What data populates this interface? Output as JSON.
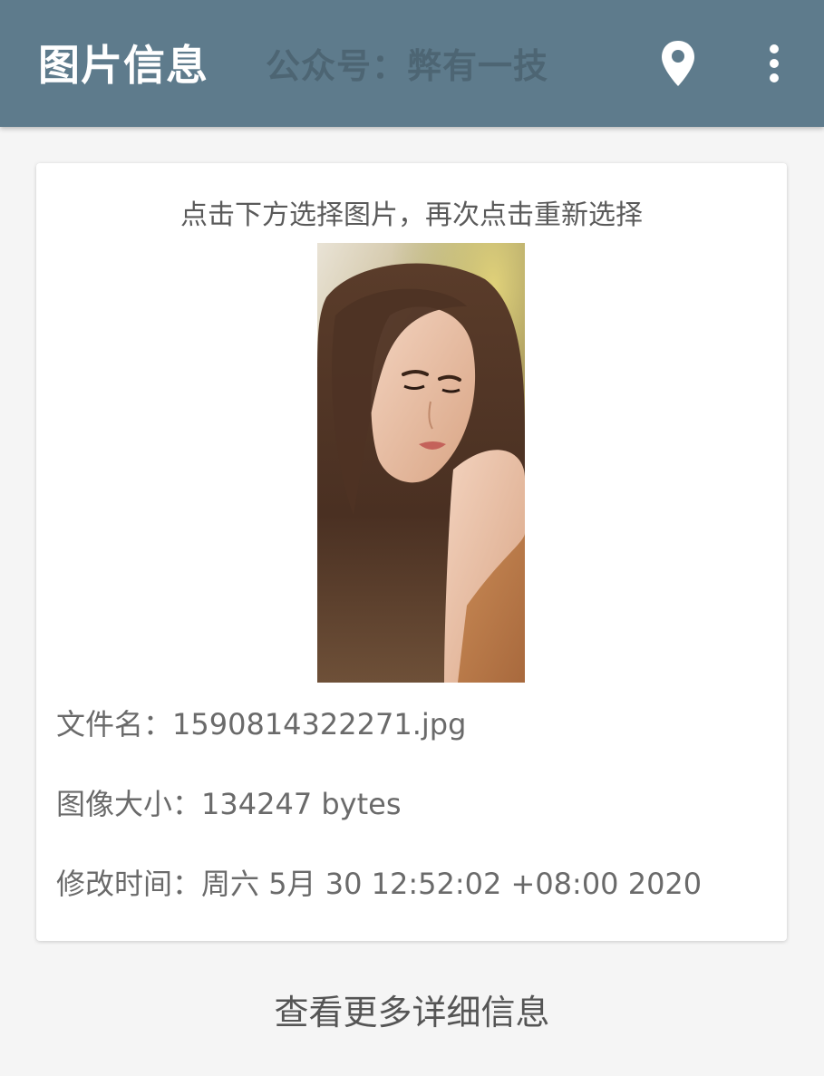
{
  "appbar": {
    "title": "图片信息",
    "watermark": "公众号：弊有一技",
    "background_color": "#5e7b8c",
    "actions": [
      {
        "icon": "location-pin-icon"
      },
      {
        "icon": "more-vert-icon"
      }
    ]
  },
  "card": {
    "hint": "点击下方选择图片，再次点击重新选择",
    "image_alt": "selected photo",
    "file_name_label": "文件名：",
    "file_name_value": "1590814322271.jpg",
    "image_size_label": "图像大小：",
    "image_size_value": "134247 bytes",
    "modified_time_label": "修改时间：",
    "modified_time_value": "周六 5月 30 12:52:02 +08:00 2020"
  },
  "more_button": {
    "label": "查看更多详细信息"
  }
}
